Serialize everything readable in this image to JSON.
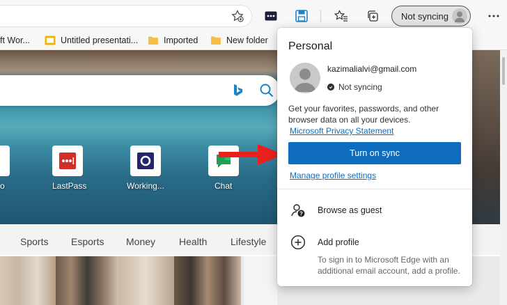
{
  "toolbar": {
    "profile_button_label": "Not syncing",
    "icons": [
      "favorite-add-icon",
      "extension-icon",
      "save-icon",
      "favorites-icon",
      "collections-icon",
      "more-icon"
    ]
  },
  "favorites_bar": [
    {
      "label": "ft Wor...",
      "icon": "word-icon"
    },
    {
      "label": "Untitled presentati...",
      "icon": "slides-icon"
    },
    {
      "label": "Imported",
      "icon": "folder-icon"
    },
    {
      "label": "New folder",
      "icon": "folder-icon"
    }
  ],
  "new_tab": {
    "tiles": [
      {
        "label": "o"
      },
      {
        "label": "LastPass",
        "icon": "lastpass-icon"
      },
      {
        "label": "Working...",
        "icon": "outlook-icon"
      },
      {
        "label": "Chat",
        "icon": "chat-icon"
      }
    ],
    "categories": [
      "Sports",
      "Esports",
      "Money",
      "Health",
      "Lifestyle"
    ]
  },
  "profile_popup": {
    "title": "Personal",
    "email": "kazimalialvi@gmail.com",
    "sync_status": "Not syncing",
    "description": "Get your favorites, passwords, and other browser data on all your devices.",
    "privacy_link": "Microsoft Privacy Statement",
    "sync_button": "Turn on sync",
    "manage_link": "Manage profile settings",
    "guest_label": "Browse as guest",
    "add_profile_label": "Add profile",
    "add_profile_hint": "To sign in to Microsoft Edge with an additional email account, add a profile."
  },
  "colors": {
    "accent": "#0f6cbd",
    "arrow": "#e8211d"
  }
}
